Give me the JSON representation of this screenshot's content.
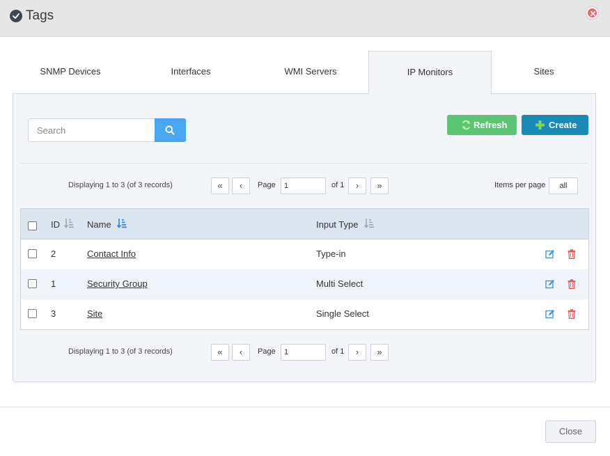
{
  "dialog": {
    "title": "Tags"
  },
  "tabs": [
    {
      "label": "SNMP Devices"
    },
    {
      "label": "Interfaces"
    },
    {
      "label": "WMI Servers"
    },
    {
      "label": "IP Monitors",
      "active": true
    },
    {
      "label": "Sites"
    }
  ],
  "search": {
    "placeholder": "Search",
    "value": ""
  },
  "toolbar": {
    "refresh_label": "Refresh",
    "create_label": "Create"
  },
  "pager": {
    "display_text": "Displaying 1 to 3 (of 3 records)",
    "first": "«",
    "prev": "‹",
    "next": "›",
    "last": "»",
    "page_label": "Page",
    "page_value": "1",
    "of_label": "of 1",
    "items_per_page_label": "Items per page",
    "items_per_page_value": "all"
  },
  "table": {
    "headers": {
      "id": "ID",
      "name": "Name",
      "input_type": "Input Type"
    },
    "rows": [
      {
        "id": "2",
        "name": "Contact Info",
        "input_type": "Type-in"
      },
      {
        "id": "1",
        "name": "Security Group",
        "input_type": "Multi Select"
      },
      {
        "id": "3",
        "name": "Site",
        "input_type": "Single Select"
      }
    ]
  },
  "footer": {
    "close_label": "Close"
  },
  "colors": {
    "accent": "#46a7f0",
    "refresh": "#5bc574",
    "create": "#1b8ab6",
    "delete": "#e05a5a",
    "edit": "#3a8fd8"
  }
}
